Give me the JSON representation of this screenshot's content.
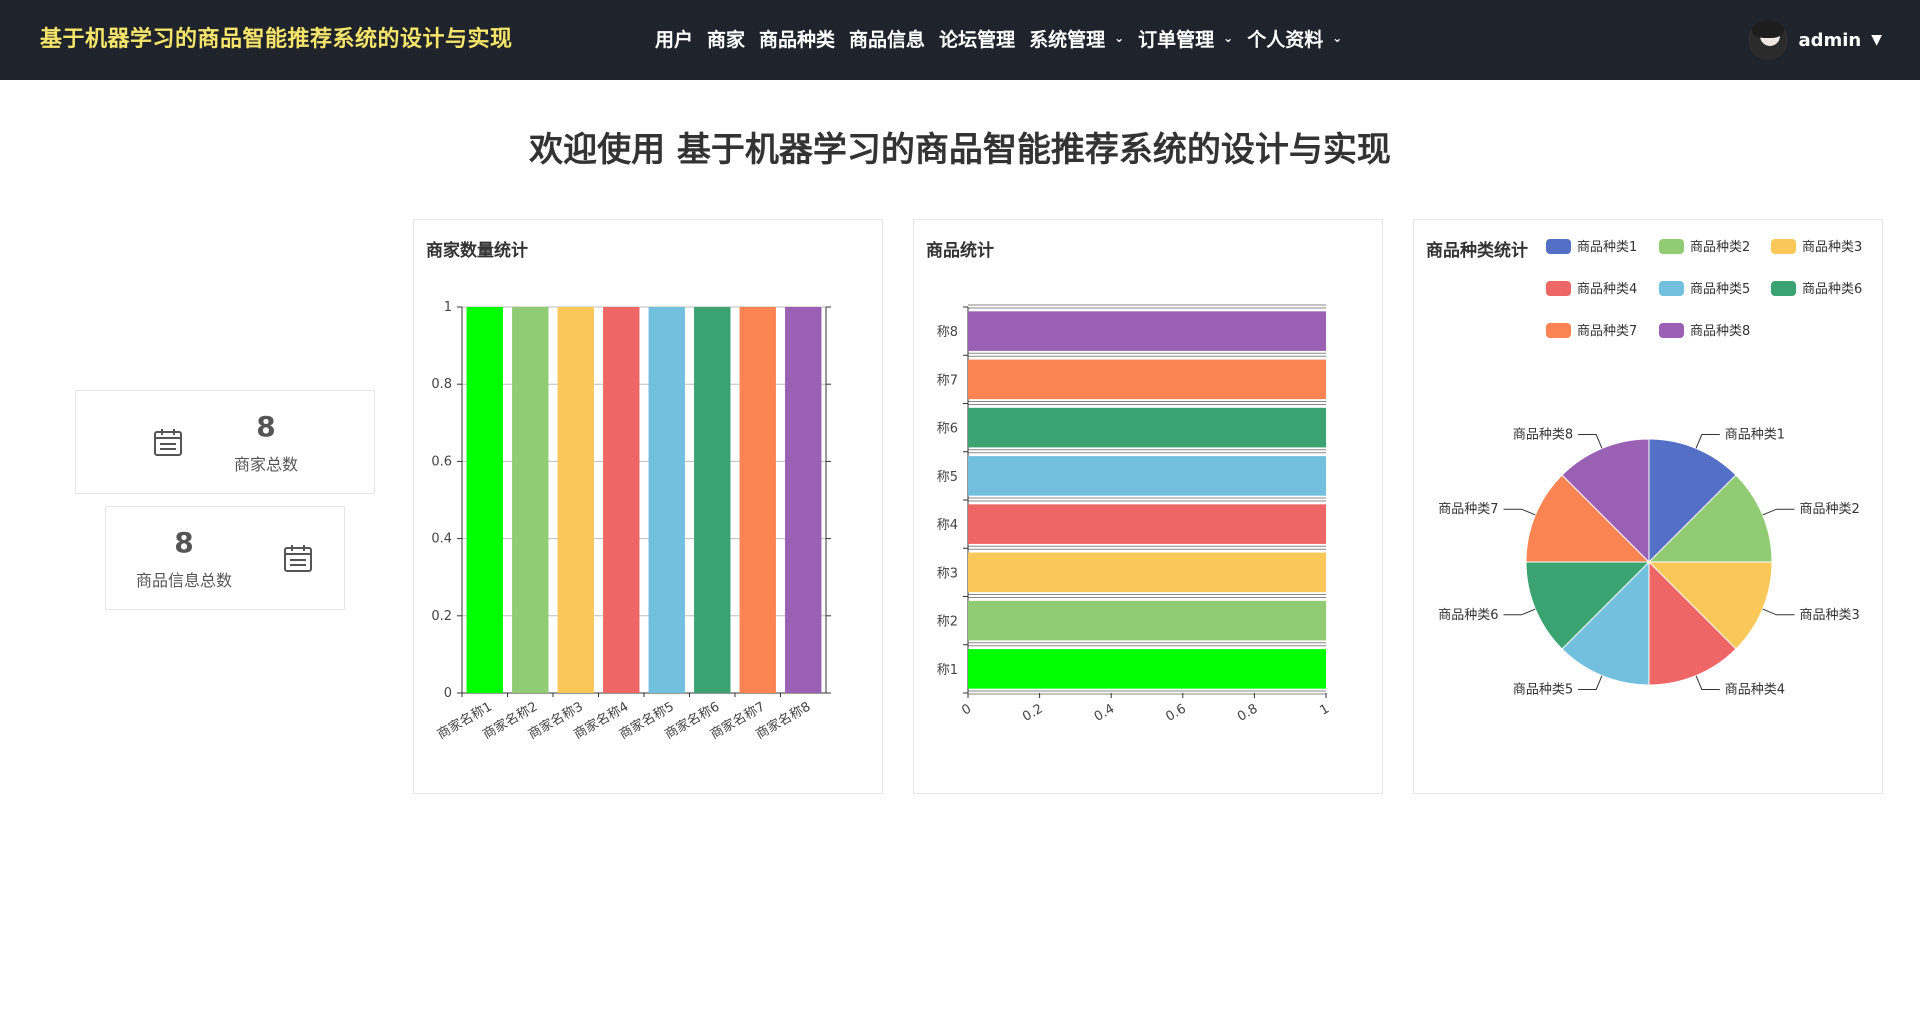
{
  "header": {
    "brand": "基于机器学习的商品智能推荐系统的设计与实现",
    "menu": [
      {
        "label": "用户",
        "dropdown": false
      },
      {
        "label": "商家",
        "dropdown": false
      },
      {
        "label": "商品种类",
        "dropdown": false
      },
      {
        "label": "商品信息",
        "dropdown": false
      },
      {
        "label": "论坛管理",
        "dropdown": false
      },
      {
        "label": "系统管理",
        "dropdown": true
      },
      {
        "label": "订单管理",
        "dropdown": true
      },
      {
        "label": "个人资料",
        "dropdown": true
      }
    ],
    "user": {
      "name": "admin",
      "caret": "▼"
    }
  },
  "welcome": "欢迎使用 基于机器学习的商品智能推荐系统的设计与实现",
  "stats": [
    {
      "value": "8",
      "label": "商家总数",
      "icon": "calendar-icon"
    },
    {
      "value": "8",
      "label": "商品信息总数",
      "icon": "calendar-icon"
    }
  ],
  "palette": [
    "#00ff00",
    "#91cc75",
    "#fac858",
    "#ee6666",
    "#73c0de",
    "#3ba272",
    "#fc8452",
    "#9a60b4"
  ],
  "pie_palette": [
    "#5470c6",
    "#91cc75",
    "#fac858",
    "#ee6666",
    "#73c0de",
    "#3ba272",
    "#fc8452",
    "#9a60b4"
  ],
  "chart_data": [
    {
      "type": "bar",
      "title": "商家数量统计",
      "categories": [
        "商家名称1",
        "商家名称2",
        "商家名称3",
        "商家名称4",
        "商家名称5",
        "商家名称6",
        "商家名称7",
        "商家名称8"
      ],
      "values": [
        1,
        1,
        1,
        1,
        1,
        1,
        1,
        1
      ],
      "yticks": [
        "0",
        "0.2",
        "0.4",
        "0.6",
        "0.8",
        "1"
      ],
      "ylim": [
        0,
        1
      ],
      "grid": true
    },
    {
      "type": "bar",
      "orientation": "horizontal",
      "title": "商品统计",
      "categories": [
        "称1",
        "称2",
        "称3",
        "称4",
        "称5",
        "称6",
        "称7",
        "称8"
      ],
      "values": [
        1,
        1,
        1,
        1,
        1,
        1,
        1,
        1
      ],
      "xticks": [
        "0",
        "0.2",
        "0.4",
        "0.6",
        "0.8",
        "1"
      ],
      "xlim": [
        0,
        1
      ],
      "grid": true
    },
    {
      "type": "pie",
      "title": "商品种类统计",
      "categories": [
        "商品种类1",
        "商品种类2",
        "商品种类3",
        "商品种类4",
        "商品种类5",
        "商品种类6",
        "商品种类7",
        "商品种类8"
      ],
      "values": [
        1,
        1,
        1,
        1,
        1,
        1,
        1,
        1
      ],
      "legend": "top-right"
    }
  ]
}
